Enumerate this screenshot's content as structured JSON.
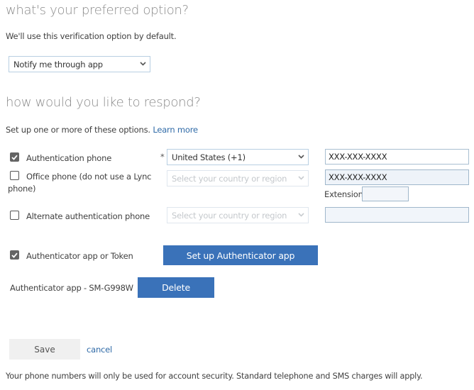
{
  "preferred": {
    "heading": "what's your preferred option?",
    "description": "We'll use this verification option by default.",
    "selected_option": "Notify me through app"
  },
  "respond": {
    "heading": "how would you like to respond?",
    "description": "Set up one or more of these options.",
    "learn_more": "Learn more"
  },
  "options": [
    {
      "label": "Authentication phone",
      "checked": true,
      "required_marker": "*",
      "country": "United States (+1)",
      "phone": "XXX-XXX-XXXX"
    },
    {
      "label_line1": "Office phone (do not use a Lync",
      "label_line2": "phone)",
      "checked": false,
      "country_placeholder": "Select your country or region",
      "phone": "XXX-XXX-XXXX",
      "extension_label": "Extension",
      "extension_value": ""
    },
    {
      "label": "Alternate authentication phone",
      "checked": false,
      "country_placeholder": "Select your country or region",
      "phone": ""
    },
    {
      "label": "Authenticator app or Token",
      "checked": true,
      "button": "Set up Authenticator app"
    }
  ],
  "device": {
    "label": "Authenticator app - SM-G998W",
    "delete_button": "Delete"
  },
  "actions": {
    "save": "Save",
    "cancel": "cancel"
  },
  "footer": "Your phone numbers will only be used for account security. Standard telephone and SMS charges will apply.",
  "colors": {
    "accent": "#3a72b9",
    "link": "#2f6aa7",
    "heading": "#8a8a8a"
  }
}
